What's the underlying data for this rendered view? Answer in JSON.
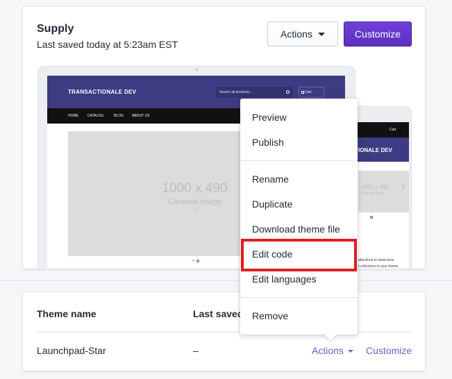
{
  "theme": {
    "title": "Supply",
    "saved": "Last saved today at 5:23am EST",
    "actions_label": "Actions",
    "customize_label": "Customize"
  },
  "preview": {
    "desktop": {
      "brand": "TRANSACTIONALE DEV",
      "search_placeholder": "Search all products...",
      "cart": "Cart",
      "nav": [
        "HOME",
        "CATALOG",
        "BLOG",
        "ABOUT US"
      ],
      "carousel_size": "1000 x 490",
      "carousel_label": "Carousel image",
      "carousel_number": "2"
    },
    "mobile": {
      "cart": "Cart",
      "brand": "TRANSACTIONALE DEV",
      "carousel_size": "1000 x 490",
      "carousel_label": "Carousel image",
      "text1": "collections to show here.",
      "text2_link": "d collections",
      "text2_rest": " in your theme"
    }
  },
  "dropdown": {
    "items": [
      "Preview",
      "Publish",
      "Rename",
      "Duplicate",
      "Download theme file",
      "Edit code",
      "Edit languages",
      "Remove"
    ],
    "highlighted": "Edit code"
  },
  "table": {
    "headers": [
      "Theme name",
      "Last saved"
    ],
    "rows": [
      {
        "name": "Launchpad-Star",
        "saved": "–",
        "actions": "Actions",
        "customize": "Customize"
      }
    ]
  },
  "colors": {
    "primary": "#5c2fbf",
    "link": "#5c6ac4",
    "highlight": "#e01b1b",
    "store_header": "#3d3b82"
  }
}
